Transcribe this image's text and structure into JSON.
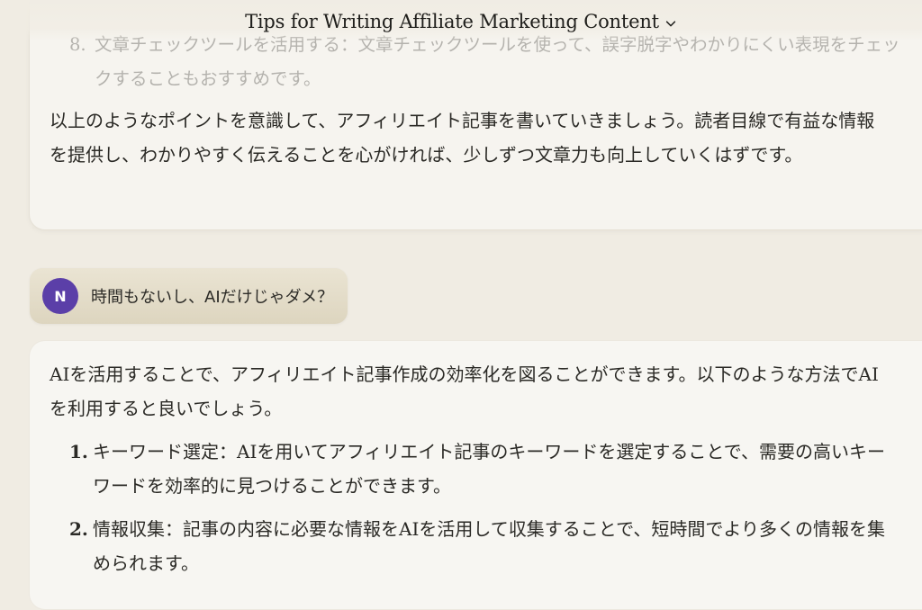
{
  "header": {
    "title": "Tips for Writing Affiliate Marketing Content",
    "dropdown_icon": "chevron-down-icon"
  },
  "previous_response": {
    "list_item": {
      "number": "8.",
      "text": "文章チェックツールを活用する：文章チェックツールを使って、誤字脱字やわかりにくい表現をチェックすることもおすすめです。"
    },
    "closing_paragraph": "以上のようなポイントを意識して、アフィリエイト記事を書いていきましょう。読者目線で有益な情報を提供し、わかりやすく伝えることを心がければ、少しずつ文章力も向上していくはずです。"
  },
  "user_message": {
    "avatar_initial": "N",
    "avatar_color": "#5b3fa8",
    "text": "時間もないし、AIだけじゃダメ？"
  },
  "response": {
    "intro": "AIを活用することで、アフィリエイト記事作成の効率化を図ることができます。以下のような方法でAIを利用すると良いでしょう。",
    "items": [
      {
        "number": "1.",
        "text": "キーワード選定：AIを用いてアフィリエイト記事のキーワードを選定することで、需要の高いキーワードを効率的に見つけることができます。"
      },
      {
        "number": "2.",
        "text": "情報収集：記事の内容に必要な情報をAIを活用して収集することで、短時間でより多くの情報を集められます。"
      }
    ]
  },
  "colors": {
    "background": "#f0ece3",
    "card": "#f7f6f2",
    "user_bubble": "#e6dfcc",
    "text": "#2b2a26"
  }
}
